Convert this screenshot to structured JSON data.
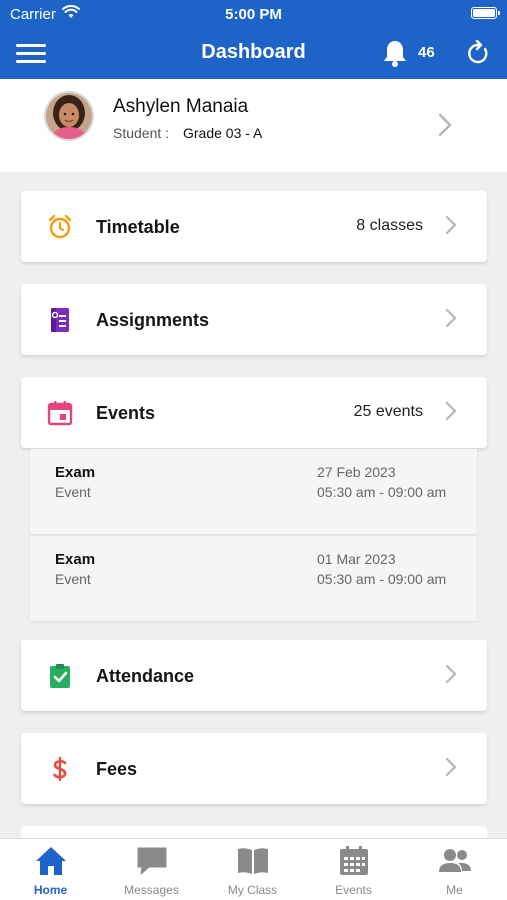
{
  "status_bar": {
    "carrier": "Carrier",
    "time": "5:00 PM"
  },
  "header": {
    "title": "Dashboard",
    "notification_count": "46"
  },
  "profile": {
    "name": "Ashylen Manaia",
    "role_label": "Student :",
    "grade": "Grade 03 - A"
  },
  "cards": {
    "timetable": {
      "label": "Timetable",
      "count": "8 classes",
      "icon": "alarm-clock-icon",
      "color": "#f39c12"
    },
    "assignments": {
      "label": "Assignments",
      "icon": "notebook-icon",
      "color": "#7b2cbf"
    },
    "events": {
      "label": "Events",
      "count": "25 events",
      "icon": "calendar-icon",
      "color": "#e0457b"
    },
    "attendance": {
      "label": "Attendance",
      "icon": "clipboard-check-icon",
      "color": "#27ae60"
    },
    "fees": {
      "label": "Fees",
      "icon": "dollar-icon",
      "color": "#e74c3c"
    }
  },
  "events_list": [
    {
      "title": "Exam",
      "type": "Event",
      "date": "27 Feb 2023",
      "time": "05:30 am - 09:00 am"
    },
    {
      "title": "Exam",
      "type": "Event",
      "date": "01 Mar 2023",
      "time": "05:30 am - 09:00 am"
    }
  ],
  "tabs": [
    {
      "label": "Home",
      "icon": "home-icon",
      "active": true
    },
    {
      "label": "Messages",
      "icon": "chat-bubble-icon",
      "active": false
    },
    {
      "label": "My Class",
      "icon": "open-book-icon",
      "active": false
    },
    {
      "label": "Events",
      "icon": "calendar-icon",
      "active": false
    },
    {
      "label": "Me",
      "icon": "people-icon",
      "active": false
    }
  ],
  "colors": {
    "primary": "#1e64c8",
    "background": "#efefef",
    "tab_inactive": "#8a8a8a"
  }
}
